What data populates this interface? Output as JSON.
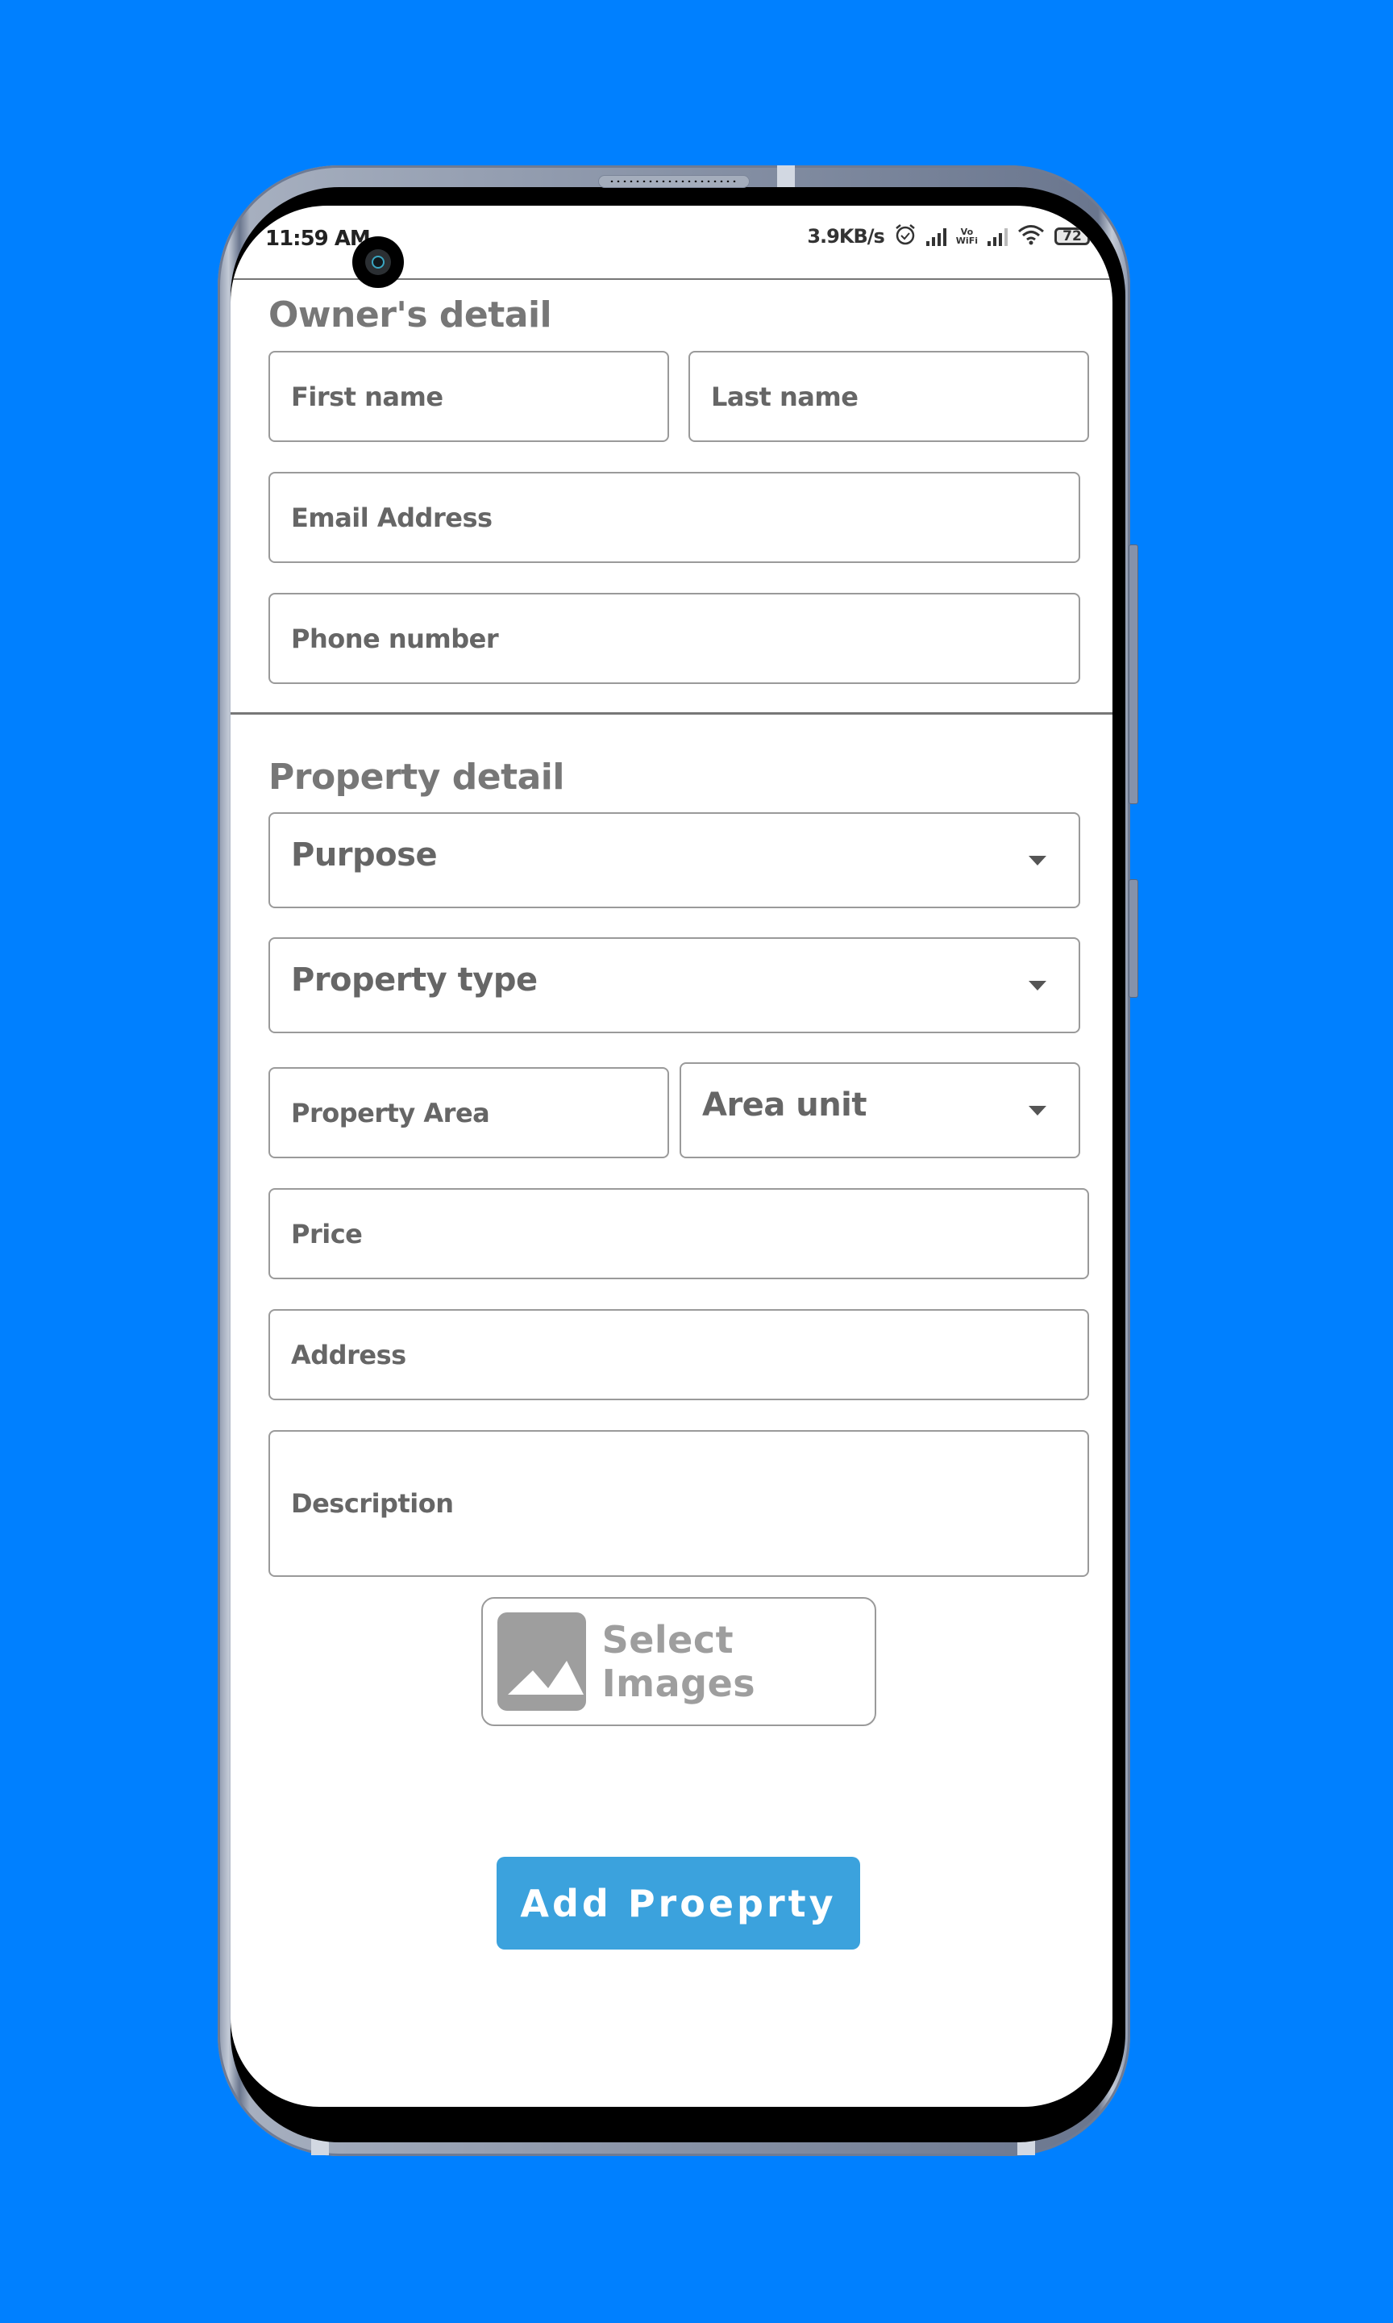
{
  "status_bar": {
    "time": "11:59 AM",
    "network_speed": "3.9KB/s",
    "icons": [
      "alarm-icon",
      "signal-icon",
      "vowifi-icon",
      "signal-icon",
      "wifi-icon",
      "battery-icon"
    ],
    "vowifi_top": "Vo",
    "vowifi_bottom": "WiFi",
    "battery_level": "72"
  },
  "owner_section": {
    "title": "Owner's detail",
    "first_name_placeholder": "First name",
    "last_name_placeholder": "Last name",
    "email_placeholder": "Email Address",
    "phone_placeholder": "Phone number"
  },
  "property_section": {
    "title": "Property detail",
    "purpose_select": "Purpose",
    "property_type_select": "Property type",
    "area_placeholder": "Property Area",
    "area_unit_select": "Area unit",
    "price_placeholder": "Price",
    "address_placeholder": "Address",
    "description_placeholder": "Description"
  },
  "select_images": {
    "label": "Select Images",
    "icon": "image-icon"
  },
  "submit": {
    "label": "Add Proeprty",
    "color": "#3ba2dd"
  },
  "colors": {
    "background": "#0080ff",
    "text_muted": "#666666",
    "border": "#9a9a9a"
  }
}
